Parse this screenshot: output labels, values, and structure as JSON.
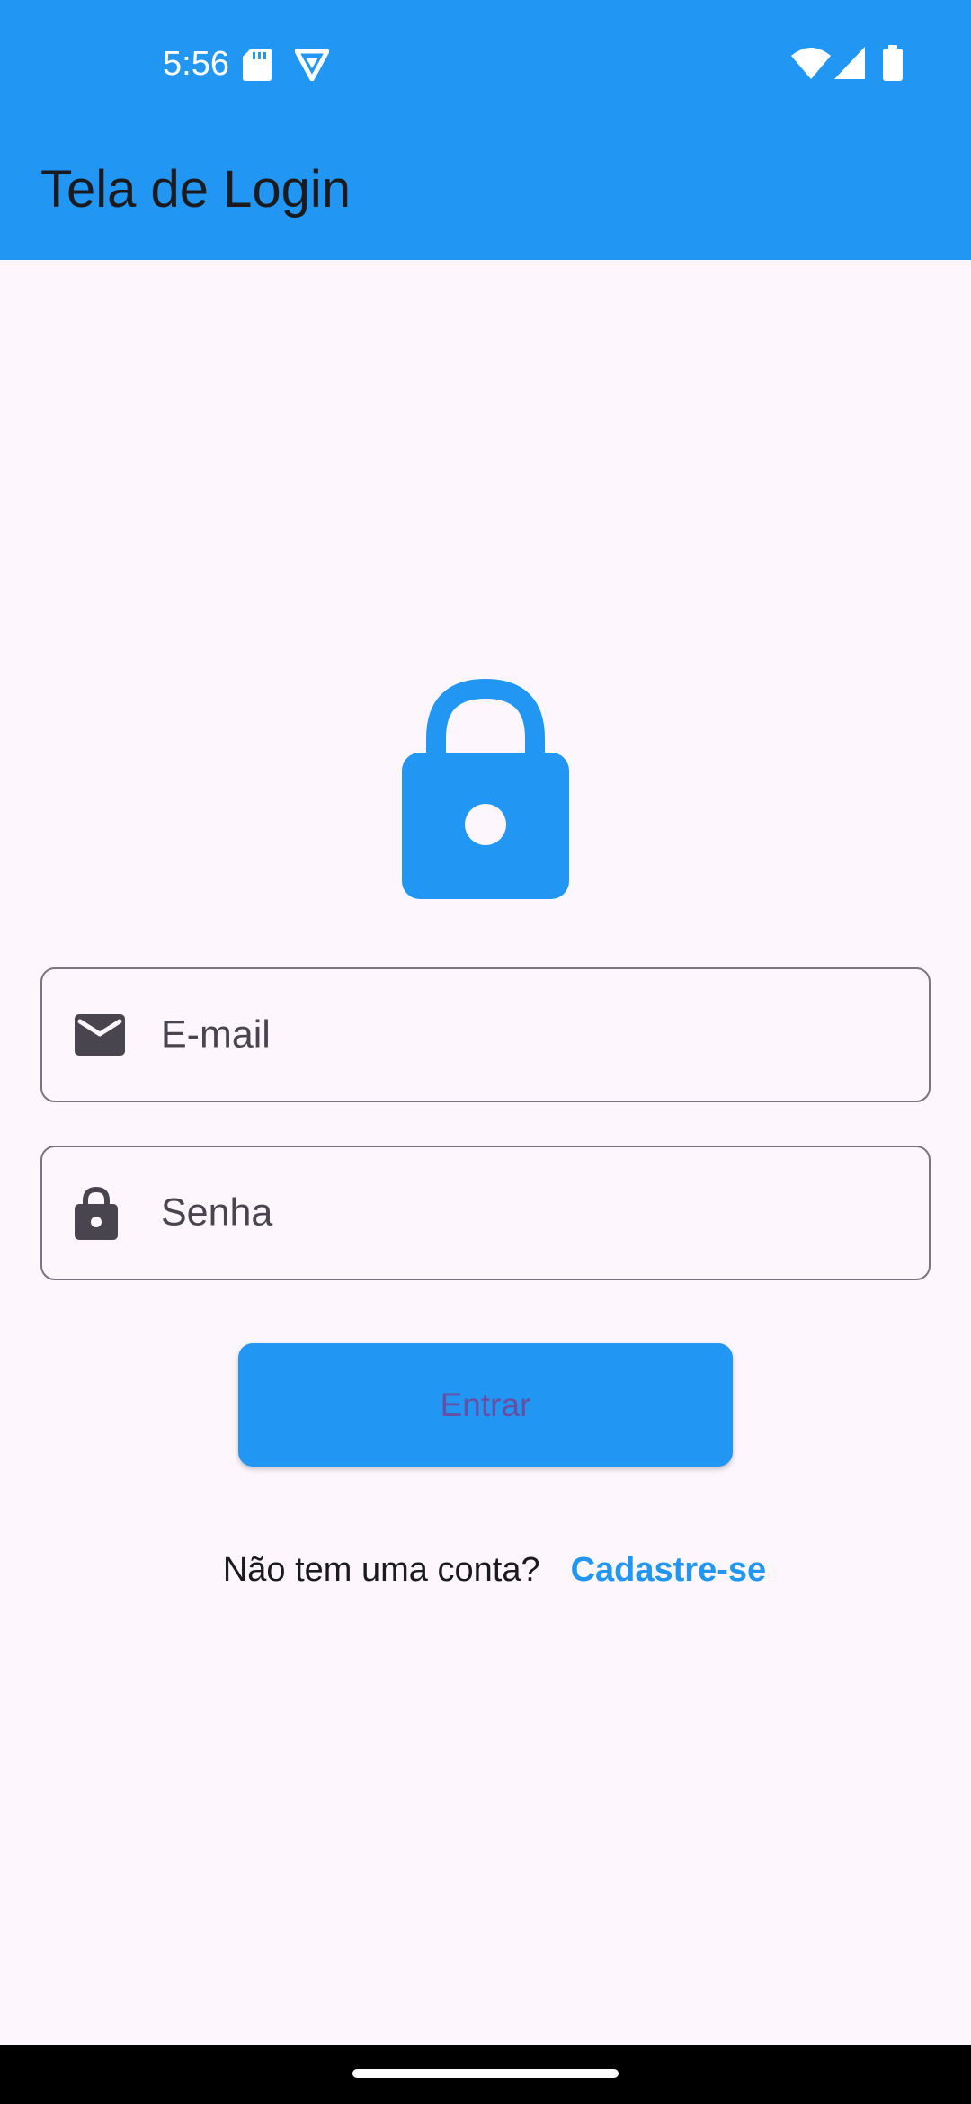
{
  "status_bar": {
    "time": "5:56",
    "icons": [
      "sd-card-icon",
      "vpn-shield-icon",
      "wifi-icon",
      "cell-signal-icon",
      "battery-icon"
    ]
  },
  "app_bar": {
    "title": "Tela de Login"
  },
  "hero_icon": "lock-icon",
  "form": {
    "email": {
      "label": "E-mail",
      "icon": "email-icon"
    },
    "password": {
      "label": "Senha",
      "icon": "lock-icon"
    },
    "submit_label": "Entrar"
  },
  "signup": {
    "prompt": "Não tem uma conta?",
    "link_label": "Cadastre-se"
  },
  "colors": {
    "primary": "#2196F3",
    "background": "#FDF7FD",
    "button_text": "#6750A4",
    "field_border": "#79747E",
    "icon_dark": "#49454F"
  }
}
